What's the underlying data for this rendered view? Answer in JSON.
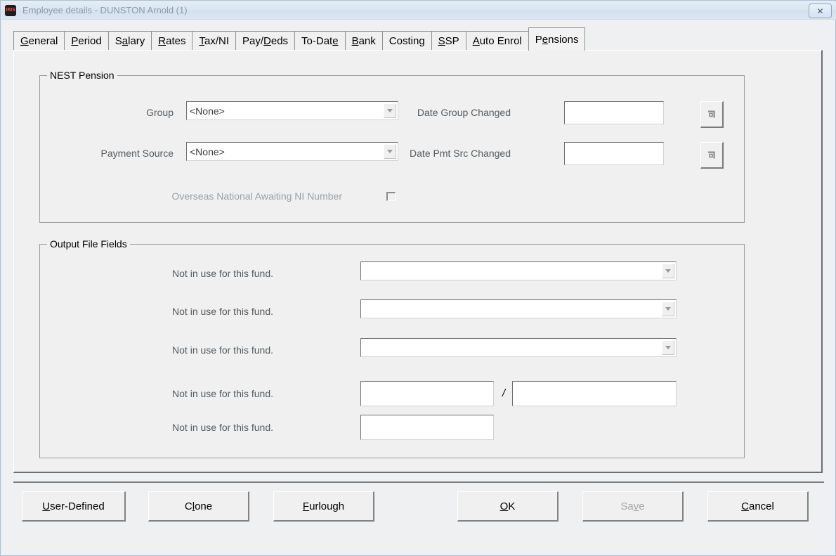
{
  "window": {
    "title": "Employee details - DUNSTON Arnold (1)",
    "app_icon": "payroll-app-icon",
    "close_label": "✕"
  },
  "tabs": [
    {
      "label": "General",
      "pre": "",
      "acc": "G",
      "post": "eneral",
      "selected": false
    },
    {
      "label": "Period",
      "pre": "",
      "acc": "P",
      "post": "eriod",
      "selected": false
    },
    {
      "label": "Salary",
      "pre": "S",
      "acc": "a",
      "post": "lary",
      "selected": false
    },
    {
      "label": "Rates",
      "pre": "",
      "acc": "R",
      "post": "ates",
      "selected": false
    },
    {
      "label": "Tax/NI",
      "pre": "",
      "acc": "T",
      "post": "ax/NI",
      "selected": false
    },
    {
      "label": "Pay/Deds",
      "pre": "Pay/",
      "acc": "D",
      "post": "eds",
      "selected": false
    },
    {
      "label": "To-Date",
      "pre": "To-Dat",
      "acc": "e",
      "post": "",
      "selected": false
    },
    {
      "label": "Bank",
      "pre": "",
      "acc": "B",
      "post": "ank",
      "selected": false
    },
    {
      "label": "Costing",
      "pre": "Costin",
      "acc": "g",
      "post": "",
      "selected": false
    },
    {
      "label": "SSP",
      "pre": "",
      "acc": "S",
      "post": "SP",
      "selected": false
    },
    {
      "label": "Auto Enrol",
      "pre": "",
      "acc": "A",
      "post": "uto Enrol",
      "selected": false
    },
    {
      "label": "Pensions",
      "pre": "P",
      "acc": "e",
      "post": "nsions",
      "selected": true
    }
  ],
  "nest_pension": {
    "title": "NEST Pension",
    "group_label": "Group",
    "group_value": "<None>",
    "payment_source_label": "Payment Source",
    "payment_source_value": "<None>",
    "date_group_changed_label": "Date Group Changed",
    "date_group_changed_value": "",
    "date_pmt_src_changed_label": "Date Pmt Src Changed",
    "date_pmt_src_changed_value": "",
    "overseas_label": "Overseas National Awaiting NI Number",
    "overseas_checked": false,
    "picker_icon": "date-picker-icon"
  },
  "output_file_fields": {
    "title": "Output File Fields",
    "rows": [
      {
        "label": "Not in use for this fund.",
        "kind": "combo",
        "value": ""
      },
      {
        "label": "Not in use for this fund.",
        "kind": "combo",
        "value": ""
      },
      {
        "label": "Not in use for this fund.",
        "kind": "combo",
        "value": ""
      },
      {
        "label": "Not in use for this fund.",
        "kind": "split",
        "value": "",
        "value2": "",
        "separator": "/"
      },
      {
        "label": "Not in use for this fund.",
        "kind": "text",
        "value": ""
      }
    ]
  },
  "buttons": [
    {
      "label": "User-Defined",
      "pre": "",
      "acc": "U",
      "post": "ser-Defined",
      "disabled": false
    },
    {
      "label": "Clone",
      "pre": "C",
      "acc": "l",
      "post": "one",
      "disabled": false
    },
    {
      "label": "Furlough",
      "pre": "",
      "acc": "F",
      "post": "urlough",
      "disabled": false
    },
    {
      "label": "OK",
      "pre": "",
      "acc": "O",
      "post": "K",
      "disabled": false
    },
    {
      "label": "Save",
      "pre": "Sa",
      "acc": "v",
      "post": "e",
      "disabled": true
    },
    {
      "label": "Cancel",
      "pre": "",
      "acc": "C",
      "post": "ancel",
      "disabled": false
    }
  ],
  "colors": {
    "window_bg": "#eff0f1",
    "panel_bg": "#f0f0f0",
    "title_text": "#8d9aa6",
    "label_text": "#555a5e",
    "disabled_text": "#9b9fa3",
    "border": "#9c9c9c"
  }
}
